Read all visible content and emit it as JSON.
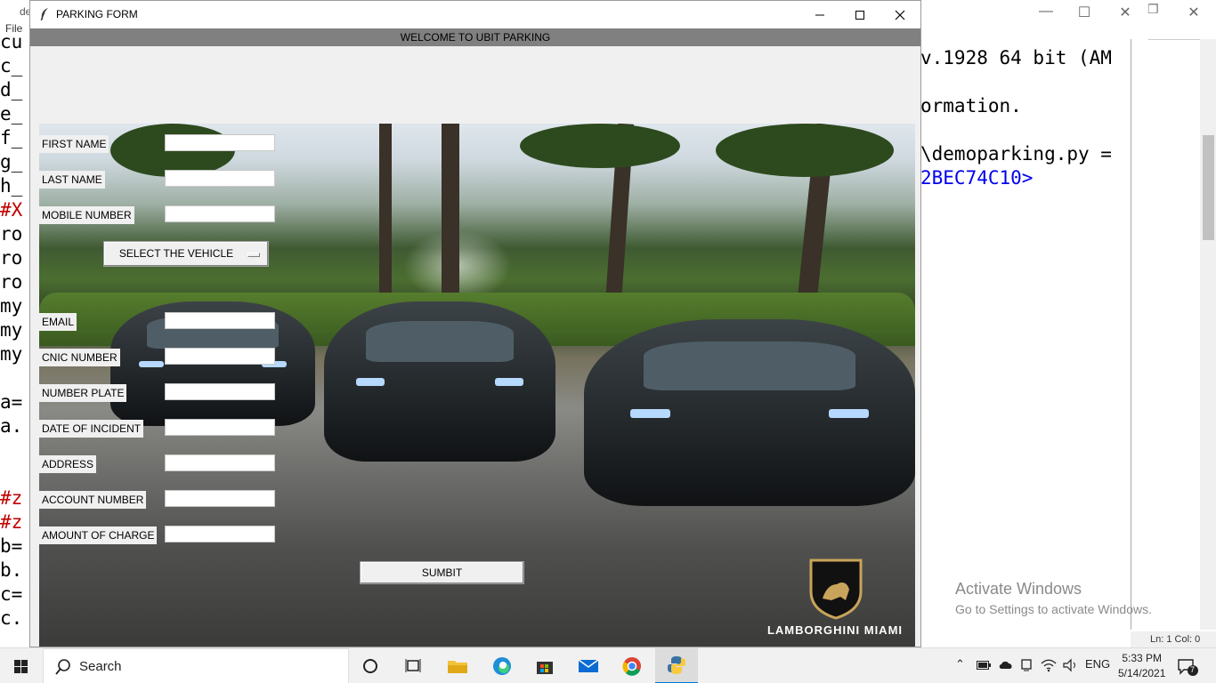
{
  "background_editor": {
    "title": "de",
    "menu": "File",
    "code_lines": [
      {
        "text": "cu",
        "red": false
      },
      {
        "text": "c_",
        "red": false
      },
      {
        "text": "d_",
        "red": false
      },
      {
        "text": "e_",
        "red": false
      },
      {
        "text": "f_",
        "red": false
      },
      {
        "text": "g_",
        "red": false
      },
      {
        "text": "h_",
        "red": false
      },
      {
        "text": "#X",
        "red": true
      },
      {
        "text": "ro",
        "red": false
      },
      {
        "text": "ro",
        "red": false
      },
      {
        "text": "ro",
        "red": false
      },
      {
        "text": "my",
        "red": false
      },
      {
        "text": "my",
        "red": false
      },
      {
        "text": "my",
        "red": false
      },
      {
        "text": "",
        "red": false
      },
      {
        "text": "a=",
        "red": false
      },
      {
        "text": "a.",
        "red": false
      },
      {
        "text": "",
        "red": false
      },
      {
        "text": "",
        "red": false
      },
      {
        "text": "#z",
        "red": true
      },
      {
        "text": "#z",
        "red": true
      },
      {
        "text": "b=",
        "red": false
      },
      {
        "text": "b.",
        "red": false
      },
      {
        "text": "c=",
        "red": false
      },
      {
        "text": "c.",
        "red": false
      }
    ]
  },
  "shell": {
    "line1": "v.1928 64 bit (AM",
    "line2": "ormation.",
    "line3": "\\demoparking.py =",
    "line4": "2BEC74C10>",
    "status": "Ln: 1   Col: 0"
  },
  "activate": {
    "title": "Activate Windows",
    "subtitle": "Go to Settings to activate Windows."
  },
  "window": {
    "title": "PARKING FORM",
    "welcome": "WELCOME TO UBIT PARKING"
  },
  "form": {
    "fields": [
      {
        "label": "FIRST NAME",
        "value": ""
      },
      {
        "label": "LAST NAME",
        "value": ""
      },
      {
        "label": "MOBILE NUMBER",
        "value": ""
      },
      {
        "label": "EMAIL",
        "value": ""
      },
      {
        "label": "CNIC NUMBER",
        "value": ""
      },
      {
        "label": "NUMBER PLATE",
        "value": ""
      },
      {
        "label": "DATE OF INCIDENT",
        "value": ""
      },
      {
        "label": "ADDRESS",
        "value": ""
      },
      {
        "label": "ACCOUNT NUMBER",
        "value": ""
      },
      {
        "label": "AMOUNT OF CHARGE",
        "value": ""
      }
    ],
    "vehicle_button": "SELECT THE VEHICLE",
    "submit_button": "SUMBIT"
  },
  "banner": {
    "brand": "LAMBORGHINI MIAMI"
  },
  "taskbar": {
    "search_label": "Search",
    "language": "ENG",
    "time": "5:33 PM",
    "date": "5/14/2021",
    "notification_count": "7"
  }
}
